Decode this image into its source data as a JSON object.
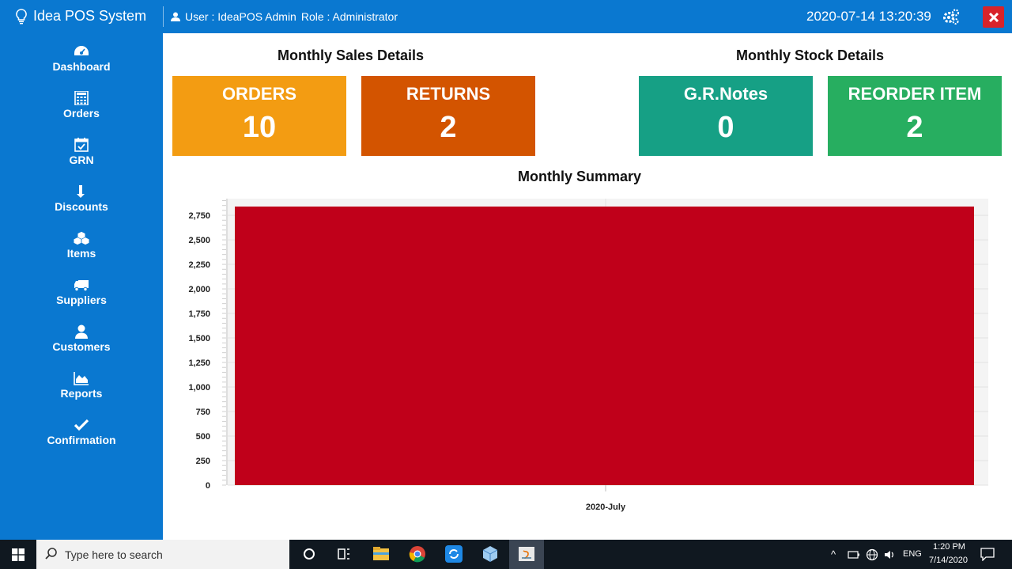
{
  "app": {
    "title": "Idea POS System",
    "user_text": "User : IdeaPOS Admin",
    "role_text": "Role : Administrator",
    "datetime": "2020-07-14 13:20:39"
  },
  "sidebar": {
    "items": [
      {
        "label": "Dashboard",
        "icon": "dashboard-icon"
      },
      {
        "label": "Orders",
        "icon": "calculator-icon"
      },
      {
        "label": "GRN",
        "icon": "calendar-check-icon"
      },
      {
        "label": "Discounts",
        "icon": "arrow-down-icon"
      },
      {
        "label": "Items",
        "icon": "cubes-icon"
      },
      {
        "label": "Suppliers",
        "icon": "truck-icon"
      },
      {
        "label": "Customers",
        "icon": "user-icon"
      },
      {
        "label": "Reports",
        "icon": "area-chart-icon"
      },
      {
        "label": "Confirmation",
        "icon": "check-icon"
      }
    ]
  },
  "sales": {
    "title": "Monthly Sales Details",
    "cards": [
      {
        "label": "ORDERS",
        "value": "10",
        "color": "#f39c12"
      },
      {
        "label": "RETURNS",
        "value": "2",
        "color": "#d35400"
      }
    ]
  },
  "stock": {
    "title": "Monthly Stock Details",
    "cards": [
      {
        "label": "G.R.Notes",
        "value": "0",
        "color": "#16a085"
      },
      {
        "label": "REORDER ITEM",
        "value": "2",
        "color": "#27ae60"
      }
    ]
  },
  "chart_title": "Monthly Summary",
  "chart_data": {
    "type": "area",
    "categories": [
      "2020-July"
    ],
    "values": [
      2920
    ],
    "ylim": [
      0,
      2920
    ],
    "yticks": [
      0,
      250,
      500,
      750,
      "1,000",
      "1,250",
      "1,500",
      "1,750",
      "2,000",
      "2,250",
      "2,500",
      "2,750"
    ],
    "color": "#c0001a",
    "grid": true
  },
  "taskbar": {
    "search_placeholder": "Type here to search",
    "time": "1:20 PM",
    "date": "7/14/2020",
    "lang": "ENG"
  }
}
